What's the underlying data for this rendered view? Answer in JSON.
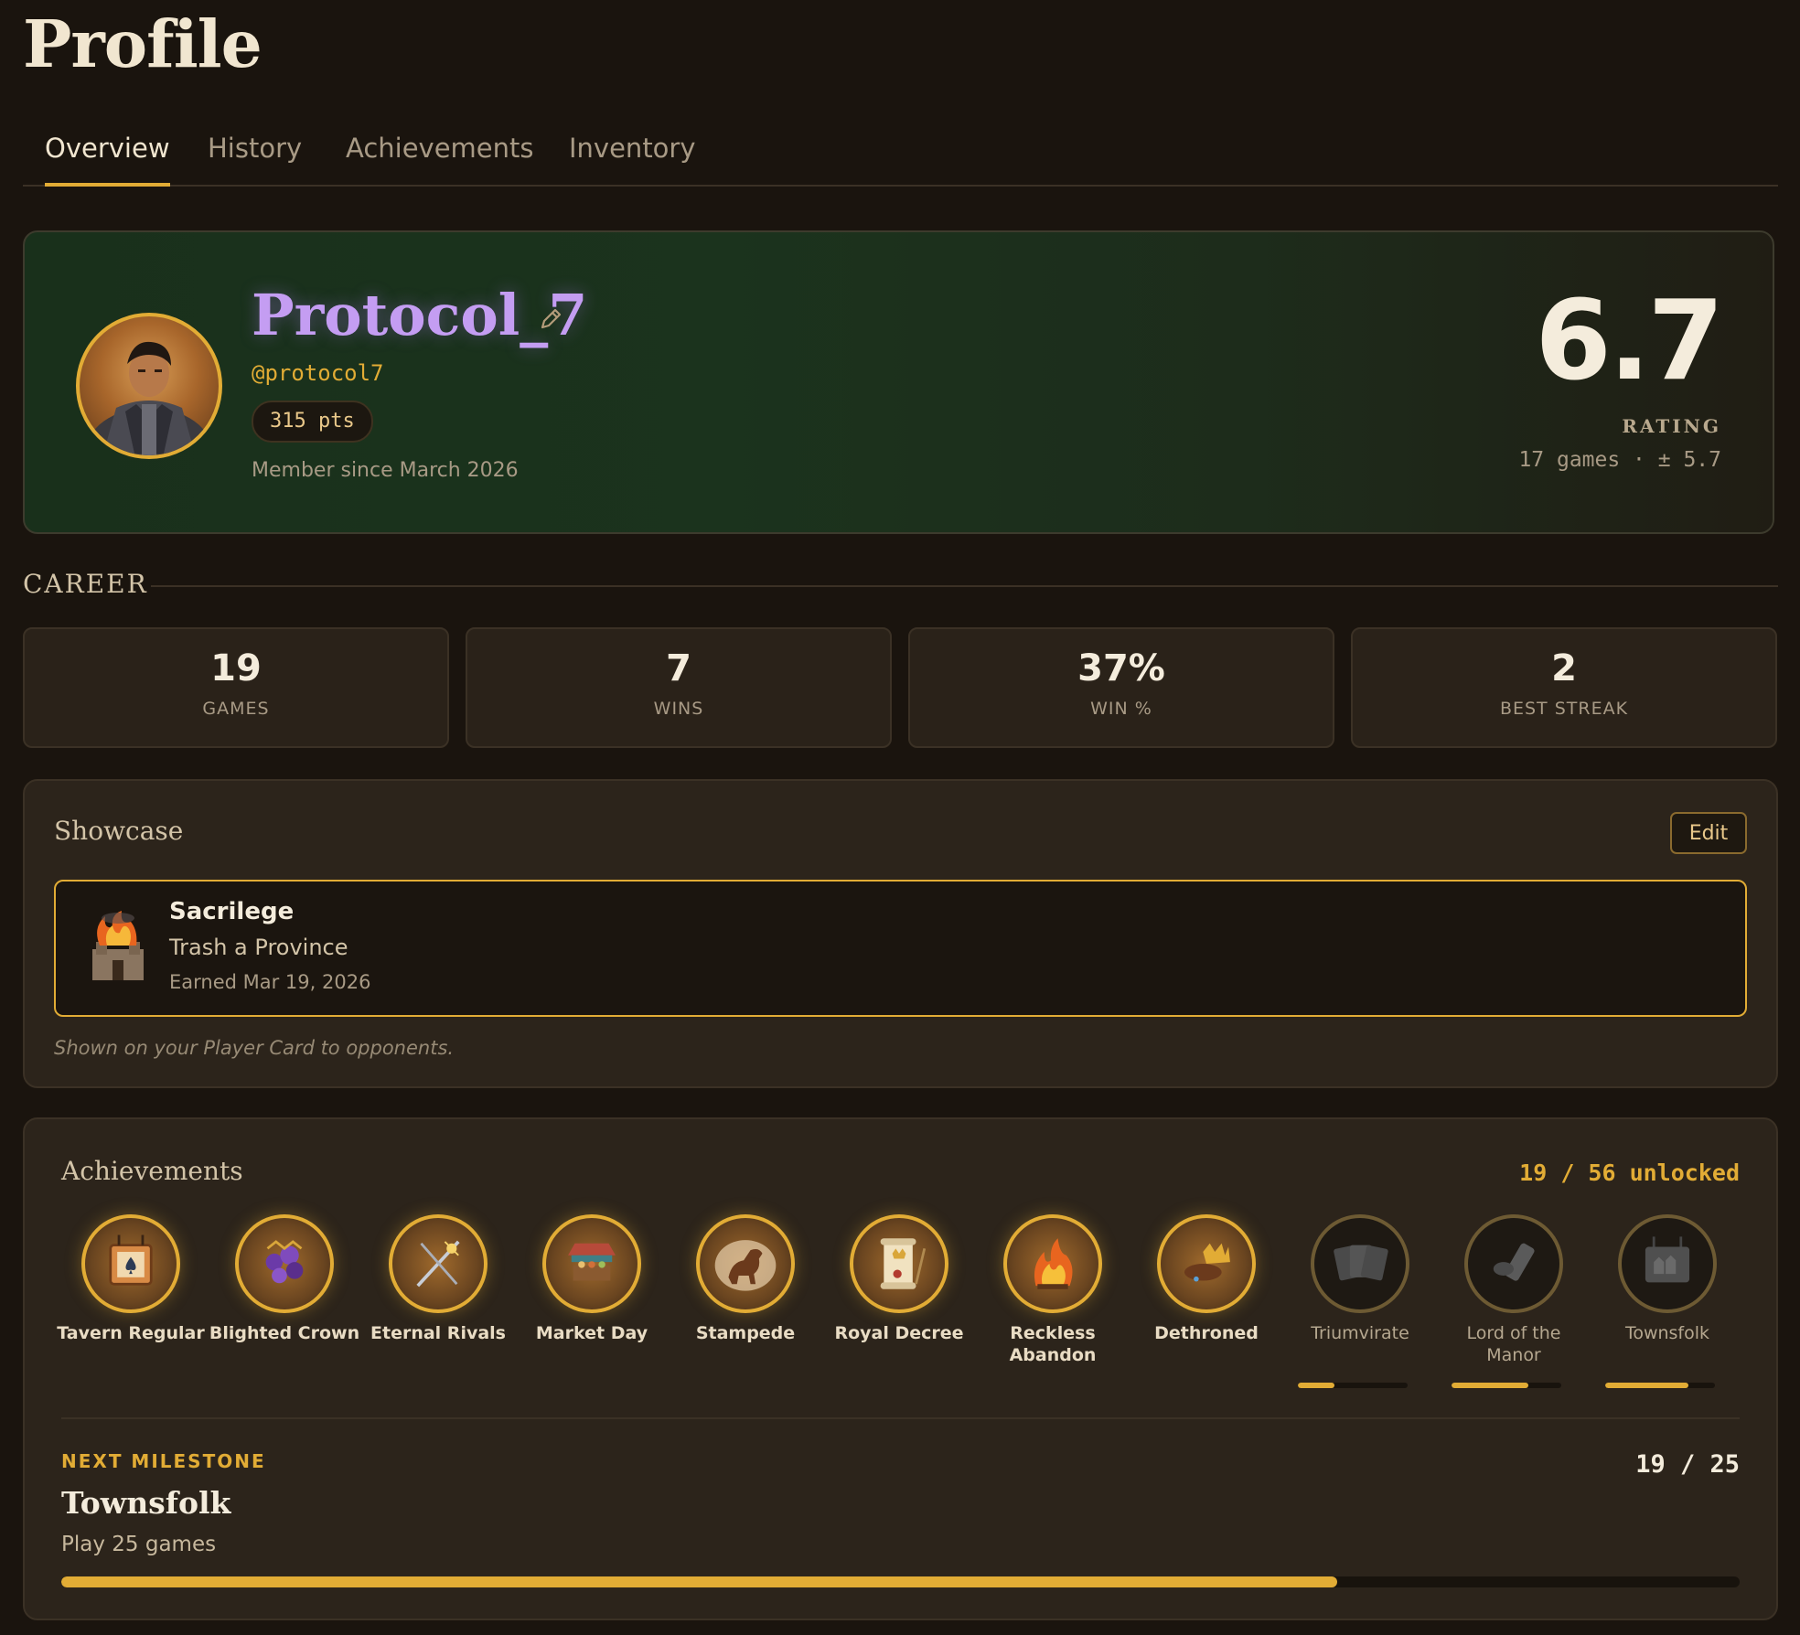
{
  "page": {
    "title": "Profile"
  },
  "tabs": [
    {
      "label": "Overview",
      "active": true
    },
    {
      "label": "History",
      "active": false
    },
    {
      "label": "Achievements",
      "active": false
    },
    {
      "label": "Inventory",
      "active": false
    }
  ],
  "profile": {
    "name": "Protocol_7",
    "handle": "@protocol7",
    "points": "315 pts",
    "member_since": "Member since March 2026",
    "rating": "6.7",
    "rating_label": "RATING",
    "rating_sub": "17 games · ± 5.7"
  },
  "career": {
    "heading": "CAREER",
    "stats": [
      {
        "value": "19",
        "label": "GAMES"
      },
      {
        "value": "7",
        "label": "WINS"
      },
      {
        "value": "37%",
        "label": "WIN %"
      },
      {
        "value": "2",
        "label": "BEST STREAK"
      }
    ]
  },
  "showcase": {
    "title": "Showcase",
    "edit_label": "Edit",
    "item": {
      "name": "Sacrilege",
      "description": "Trash a Province",
      "earned": "Earned Mar 19, 2026",
      "icon": "burning-castle-icon"
    },
    "note": "Shown on your Player Card to opponents."
  },
  "achievements": {
    "title": "Achievements",
    "count": "19 / 56 unlocked",
    "badges": [
      {
        "name": "Tavern Regular",
        "icon": "tavern-sign-icon",
        "unlocked": true
      },
      {
        "name": "Blighted Crown",
        "icon": "blighted-crown-icon",
        "unlocked": true
      },
      {
        "name": "Eternal Rivals",
        "icon": "crossed-swords-icon",
        "unlocked": true
      },
      {
        "name": "Market Day",
        "icon": "market-stall-icon",
        "unlocked": true
      },
      {
        "name": "Stampede",
        "icon": "horse-icon",
        "unlocked": true
      },
      {
        "name": "Royal Decree",
        "icon": "scroll-icon",
        "unlocked": true
      },
      {
        "name": "Reckless Abandon",
        "icon": "bonfire-icon",
        "unlocked": true
      },
      {
        "name": "Dethroned",
        "icon": "fallen-crown-icon",
        "unlocked": true
      },
      {
        "name": "Triumvirate",
        "icon": "three-cards-icon",
        "unlocked": false,
        "progress": 0.33
      },
      {
        "name": "Lord of the Manor",
        "icon": "scroll-pile-icon",
        "unlocked": false,
        "progress": 0.7
      },
      {
        "name": "Townsfolk",
        "icon": "town-sign-icon",
        "unlocked": false,
        "progress": 0.76
      }
    ]
  },
  "milestone": {
    "label": "NEXT MILESTONE",
    "name": "Townsfolk",
    "description": "Play 25 games",
    "count": "19 / 25",
    "progress": 0.76
  },
  "colors": {
    "accent": "#e2ac35",
    "background": "#1a140e",
    "name": "#c49df2"
  }
}
